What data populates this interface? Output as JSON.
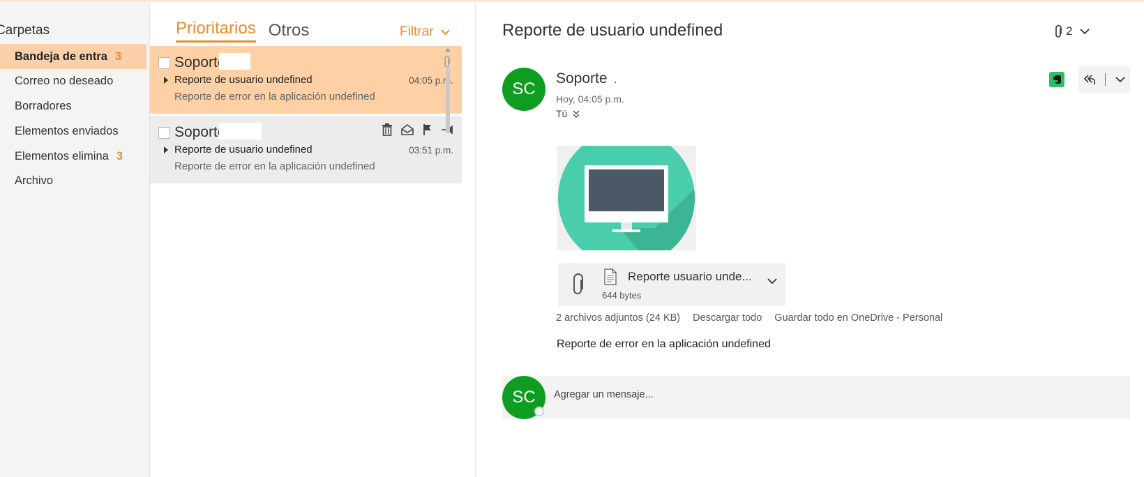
{
  "folders": {
    "title": "Carpetas",
    "items": [
      {
        "label": "Bandeja de entra",
        "count": "3"
      },
      {
        "label": "Correo no deseado",
        "count": ""
      },
      {
        "label": "Borradores",
        "count": ""
      },
      {
        "label": "Elementos enviados",
        "count": ""
      },
      {
        "label": "Elementos elimina",
        "count": "3"
      },
      {
        "label": "Archivo",
        "count": ""
      }
    ]
  },
  "list": {
    "tabs": [
      {
        "label": "Prioritarios"
      },
      {
        "label": "Otros"
      }
    ],
    "filter_label": "Filtrar",
    "messages": [
      {
        "sender": "Soporte",
        "subject": "Reporte de usuario undefined",
        "time": "04:05 p.m.",
        "preview": "Reporte de error en la aplicación undefined"
      },
      {
        "sender": "Soporte",
        "subject": "Reporte de usuario undefined",
        "time": "03:51 p.m.",
        "preview": "Reporte de error en la aplicación undefined"
      }
    ]
  },
  "reader": {
    "subject": "Reporte de usuario undefined",
    "attachment_count": "2",
    "sender_initials": "SC",
    "sender_name": "Soporte",
    "sender_suffix": ".",
    "date": "Hoy, 04:05 p.m.",
    "to": "Tú",
    "attachment": {
      "name": "Reporte usuario unde...",
      "size": "644 bytes"
    },
    "attachments_summary": "2 archivos adjuntos (24 KB)",
    "download_all": "Descargar todo",
    "save_onedrive": "Guardar todo en OneDrive - Personal",
    "body": "Reporte de error en la aplicación undefined",
    "compose_placeholder": "Agregar un mensaje...",
    "my_initials": "SC"
  },
  "colors": {
    "accent": "#ea8a2f",
    "selected_bg": "#fdd0a6",
    "avatar": "#0f9d21",
    "evernote": "#2dbe60"
  }
}
